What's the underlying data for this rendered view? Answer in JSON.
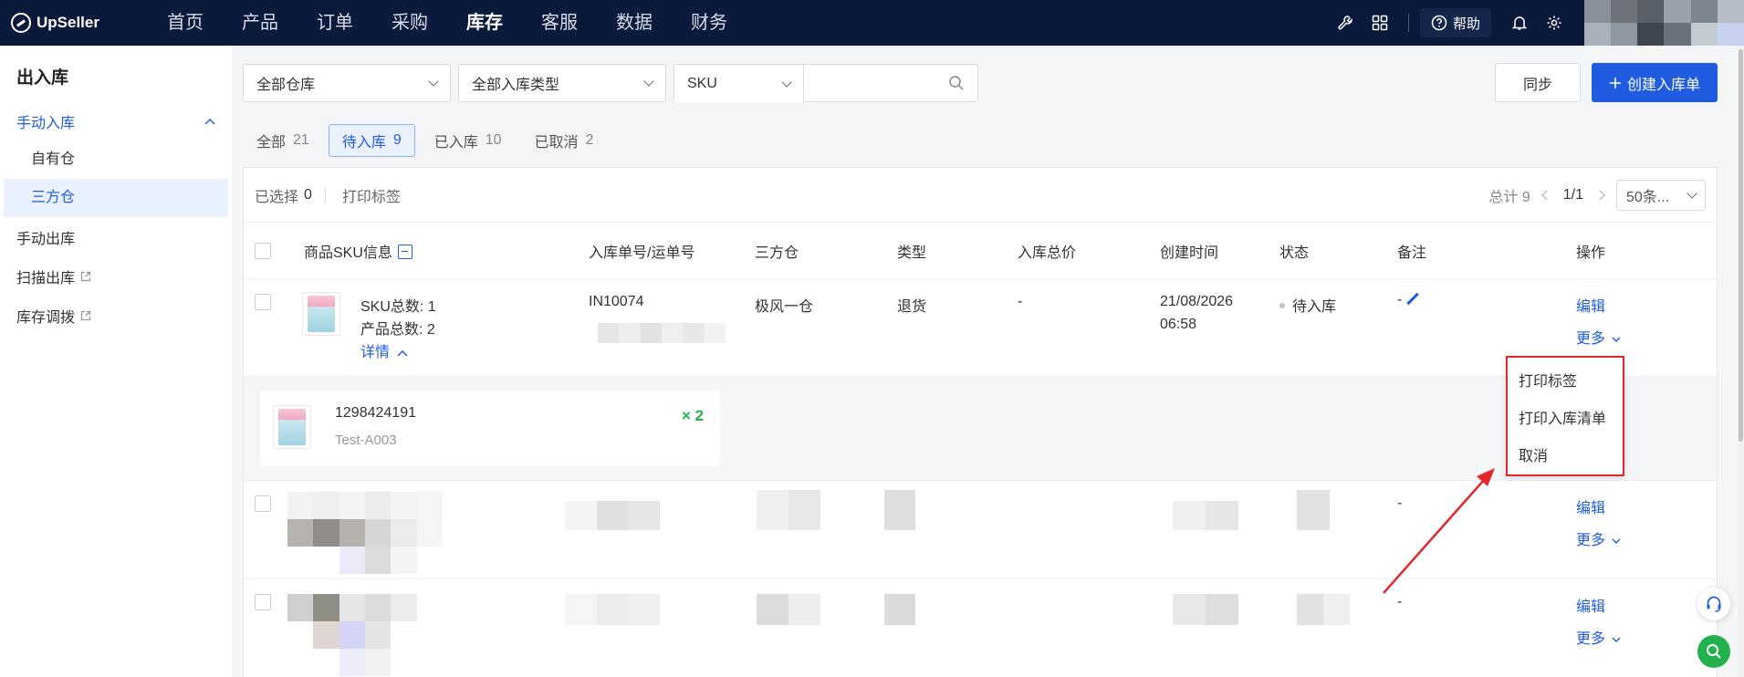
{
  "brand": {
    "name": "UpSeller"
  },
  "nav": {
    "items": [
      "首页",
      "产品",
      "订单",
      "采购",
      "库存",
      "客服",
      "数据",
      "财务"
    ],
    "active_index": 4,
    "help_label": "帮助"
  },
  "sidebar": {
    "title": "出入库",
    "group_label": "手动入库",
    "sub_items": [
      "自有仓",
      "三方仓"
    ],
    "items": [
      "手动出库",
      "扫描出库",
      "库存调拨"
    ]
  },
  "filters": {
    "warehouse": "全部仓库",
    "inbound_type": "全部入库类型",
    "search_field": "SKU",
    "search_value": ""
  },
  "actions": {
    "sync": "同步",
    "create": "创建入库单"
  },
  "tabs": [
    {
      "label": "全部",
      "count": "21"
    },
    {
      "label": "待入库",
      "count": "9"
    },
    {
      "label": "已入库",
      "count": "10"
    },
    {
      "label": "已取消",
      "count": "2"
    }
  ],
  "toolbar": {
    "selected_label": "已选择",
    "selected_count": "0",
    "print_label": "打印标签",
    "total": "总计 9",
    "page": "1/1",
    "page_size": "50条..."
  },
  "table": {
    "headers": {
      "sku_info": "商品SKU信息",
      "order_no": "入库单号/运单号",
      "warehouse": "三方仓",
      "type": "类型",
      "total_price": "入库总价",
      "created": "创建时间",
      "status": "状态",
      "remark": "备注",
      "ops": "操作"
    },
    "row1": {
      "sku_total": "SKU总数: 1",
      "product_total": "产品总数: 2",
      "details_label": "详情",
      "order_no": "IN10074",
      "warehouse": "极风一仓",
      "type": "退货",
      "total_price": "-",
      "created_date": "21/08/2026",
      "created_time": "06:58",
      "status": "待入库",
      "remark": "-",
      "edit": "编辑",
      "more": "更多"
    },
    "detail": {
      "id": "1298424191",
      "sku": "Test-A003",
      "qty": "× 2"
    },
    "row2": {
      "remark": "-",
      "edit": "编辑",
      "more": "更多"
    },
    "row3": {
      "remark": "-",
      "edit": "编辑",
      "more": "更多"
    }
  },
  "menu": {
    "items": [
      "打印标签",
      "打印入库清单",
      "取消"
    ]
  },
  "colors": {
    "nav_bg": "#0b1a3a",
    "accent": "#1f5ce0",
    "highlight": "#e3262e",
    "success": "#22b14c"
  }
}
